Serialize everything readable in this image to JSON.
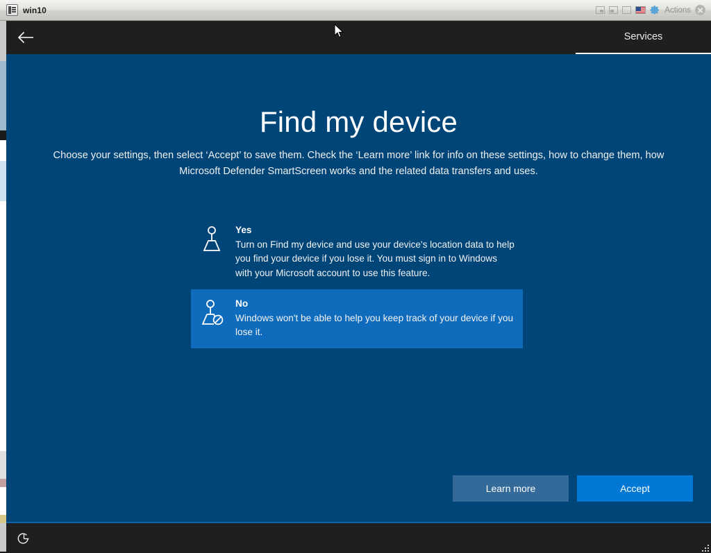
{
  "window": {
    "title": "win10",
    "icon": "vm-console-icon",
    "controls": {
      "seamless_label": "seamless-mode-icon",
      "scaled_label": "scaled-mode-icon",
      "fullscreen_label": "fullscreen-icon",
      "keyboard_layout": "us-flag-icon",
      "settings": "gear-icon",
      "actions_label": "Actions",
      "close_label": "close-icon"
    },
    "resize_grip": "resize-grip-icon"
  },
  "oobe": {
    "header": {
      "back_label": "back-arrow-icon",
      "tab_label": "Services"
    },
    "title": "Find my device",
    "subtitle": "Choose your settings, then select ‘Accept’ to save them. Check the ‘Learn more’ link for info on these settings, how to change them, how Microsoft Defender SmartScreen works and the related data transfers and uses.",
    "options": [
      {
        "id": "yes",
        "title": "Yes",
        "description": "Turn on Find my device and use your device's location data to help you find your device if you lose it. You must sign in to Windows with your Microsoft account to use this feature.",
        "icon": "find-my-device-icon",
        "selected": false
      },
      {
        "id": "no",
        "title": "No",
        "description": "Windows won't be able to help you keep track of your device if you lose it.",
        "icon": "find-my-device-disabled-icon",
        "selected": true
      }
    ],
    "buttons": {
      "learn_more": "Learn more",
      "accept": "Accept"
    }
  },
  "taskbar": {
    "power_label": "power-icon"
  },
  "colors": {
    "page_background": "#004578",
    "selected_option": "#0f6cbd",
    "accept_button": "#0078d4",
    "learn_more_button": "#336a99",
    "header_bar": "#1f1f1f",
    "taskbar_accent": "#0a64a8"
  }
}
